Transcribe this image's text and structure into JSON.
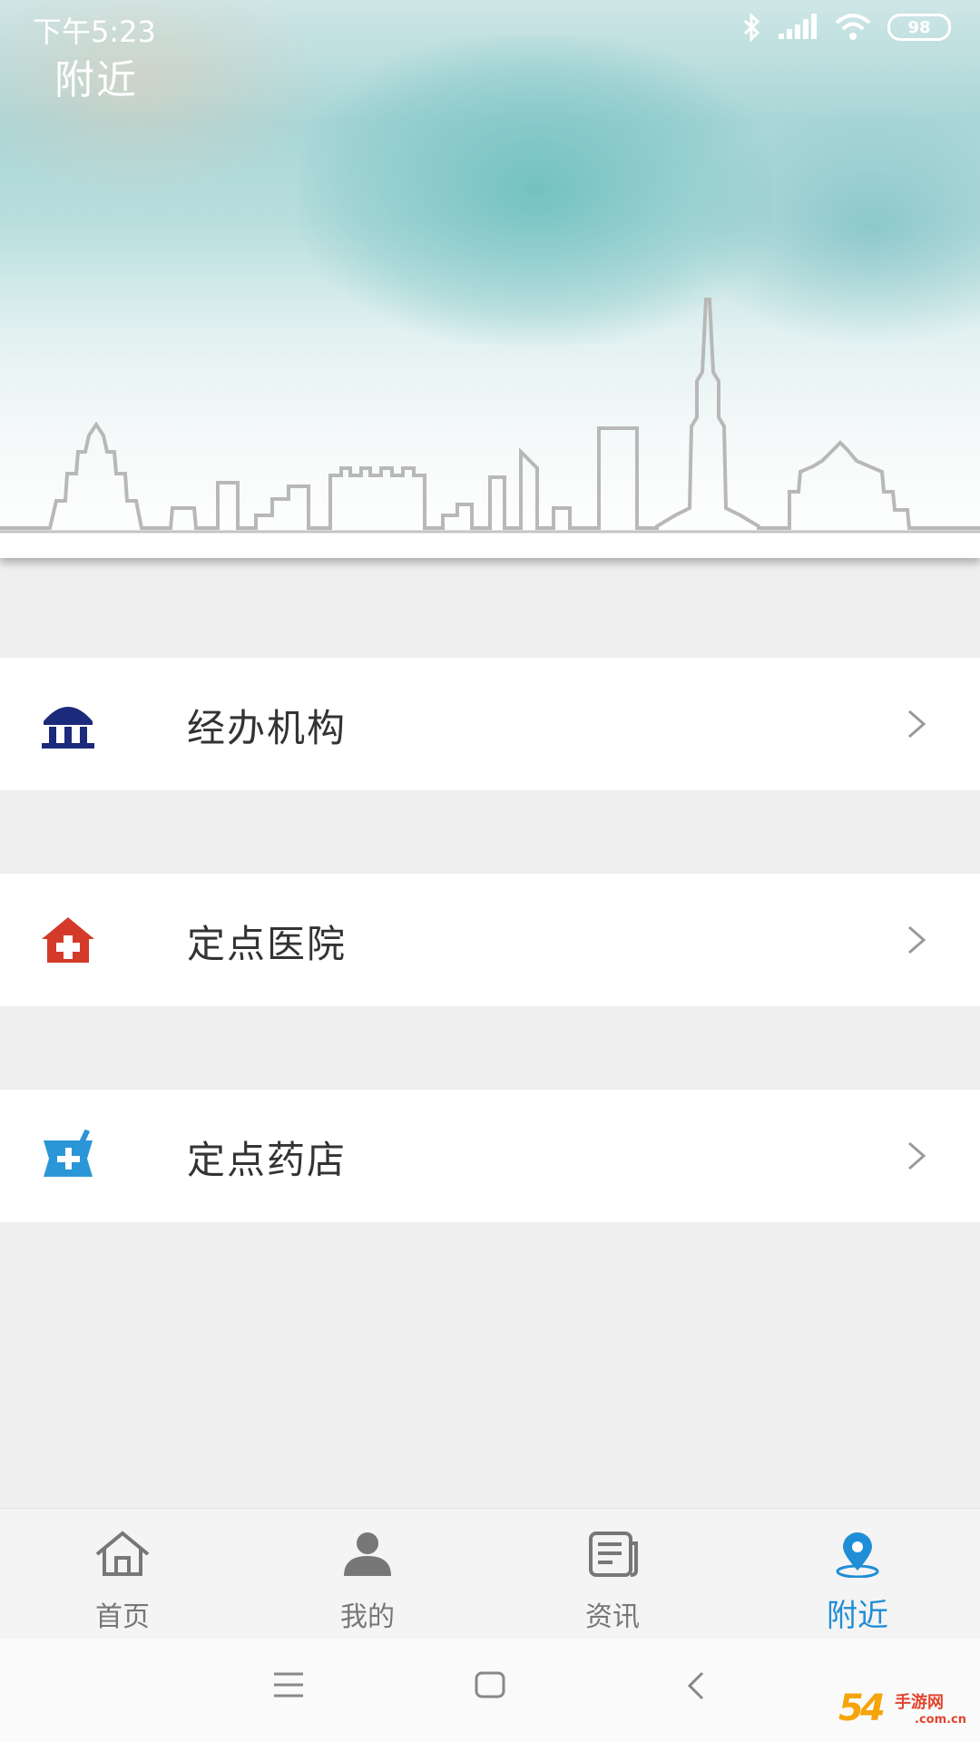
{
  "status_bar": {
    "time": "下午5:23",
    "battery": "98"
  },
  "header": {
    "title": "附近"
  },
  "menu": [
    {
      "label": "经办机构",
      "icon": "institution-icon",
      "color": "#1b2a7a"
    },
    {
      "label": "定点医院",
      "icon": "hospital-icon",
      "color": "#d43a2a"
    },
    {
      "label": "定点药店",
      "icon": "pharmacy-icon",
      "color": "#2a96d8"
    }
  ],
  "bottom_nav": {
    "items": [
      {
        "label": "首页",
        "icon": "home-icon"
      },
      {
        "label": "我的",
        "icon": "user-icon"
      },
      {
        "label": "资讯",
        "icon": "news-icon"
      },
      {
        "label": "附近",
        "icon": "location-pin-icon"
      }
    ],
    "active_index": 3,
    "active_color": "#1f8ed6"
  },
  "watermark": {
    "brand": "54",
    "tag": "手游网",
    "url": ".com.cn"
  }
}
